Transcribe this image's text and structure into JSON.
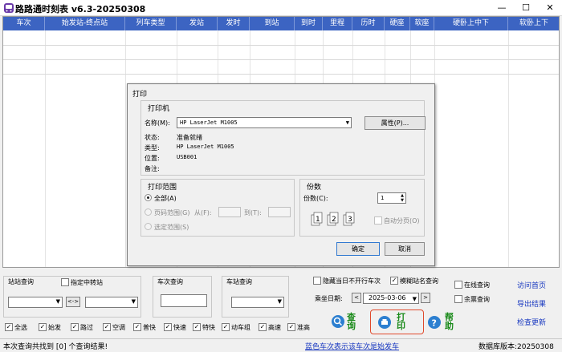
{
  "app": {
    "title": "路路通时刻表 v6.3-20250308"
  },
  "window": {
    "minimize": "—",
    "maximize": "☐",
    "close": "✕"
  },
  "grid": {
    "columns": [
      "车次",
      "始发站-终点站",
      "列车类型",
      "发站",
      "发时",
      "到站",
      "到时",
      "里程",
      "历时",
      "硬座",
      "软座",
      "硬卧上中下",
      "软卧上下"
    ]
  },
  "dialog": {
    "title": "打印",
    "printer_group": "打印机",
    "name_label": "名称(M):",
    "name_value": "HP LaserJet M1005",
    "properties_button": "属性(P)...",
    "status_label": "状态:",
    "status_value": "准备就绪",
    "type_label": "类型:",
    "type_value": "HP LaserJet M1005",
    "where_label": "位置:",
    "where_value": "USB001",
    "comment_label": "备注:",
    "range_group": "打印范围",
    "range_all": "全部(A)",
    "range_pages": "页码范围(G)",
    "range_from": "从(F):",
    "range_to": "到(T):",
    "range_selection": "选定范围(S)",
    "copies_group": "份数",
    "copies_label": "份数(C):",
    "copies_value": "1",
    "collate_label": "自动分页(O)",
    "ok_button": "确定",
    "cancel_button": "取消"
  },
  "bottom": {
    "station_query": "站站查询",
    "via_transfer": "指定中转站",
    "swap": "<->",
    "train_query": "车次查询",
    "station_stop_query": "车站查询",
    "hide_non_running": "隐藏当日不开行车次",
    "fuzzy_station": "模糊站名查询",
    "ride_date_label": "乘坐日期:",
    "ride_date_value": "2025-03-06",
    "prev": "<",
    "next": ">",
    "online_query": "在线查询",
    "remaining_tickets": "余票查询",
    "query_button": "查询",
    "print_button": "打印",
    "help_button": "帮助",
    "visit_home": "访问首页",
    "export_results": "导出结果",
    "check_update": "检查更新",
    "filters": [
      "全选",
      "始发",
      "路过",
      "空调",
      "普快",
      "快速",
      "特快",
      "动车组",
      "高速",
      "准高"
    ]
  },
  "status": {
    "left": "本次查询共找到 [0] 个查询结果!",
    "middle": "蓝色车次表示该车次是始发车",
    "right": "数据库版本:20250308"
  },
  "colors": {
    "header": "#3c64c2",
    "link": "#1838c0",
    "green": "#1a8a1a"
  }
}
